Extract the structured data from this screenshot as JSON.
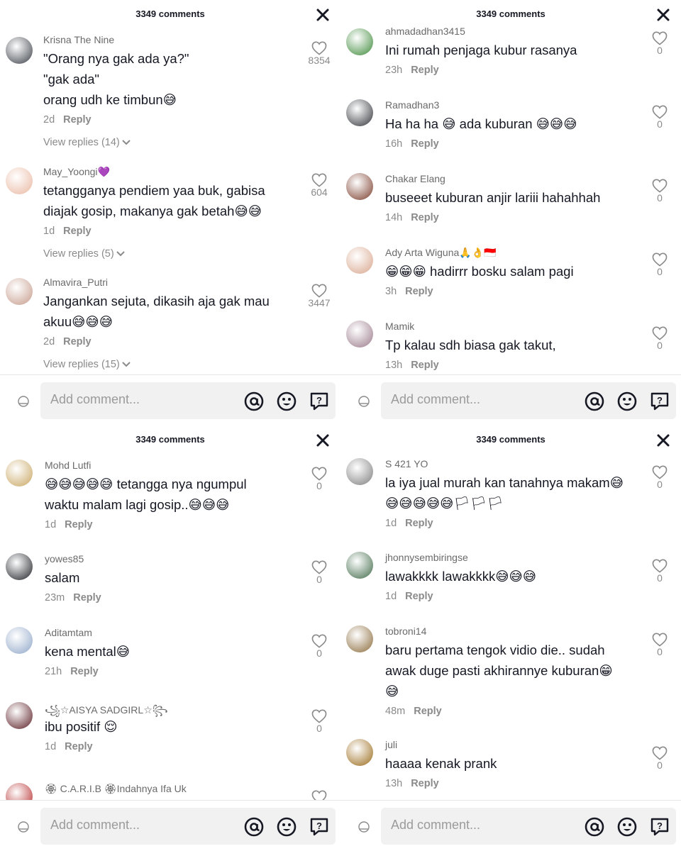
{
  "header": {
    "count_label": "3349 comments"
  },
  "footer": {
    "placeholder": "Add comment..."
  },
  "reply_label": "Reply",
  "panels": [
    {
      "comments": [
        {
          "user": "Krisna The Nine",
          "lines": [
            "\"Orang nya gak ada ya?\"",
            "\"gak ada\"",
            "orang udh ke timbun😅"
          ],
          "time": "2d",
          "likes": "8354",
          "replies": "View replies (14)"
        },
        {
          "user": "May_Yoongi💜",
          "lines": [
            "tetangganya pendiem yaa buk, gabisa",
            "diajak gosip, makanya gak betah😅😅"
          ],
          "time": "1d",
          "likes": "604",
          "replies": "View replies (5)"
        },
        {
          "user": "Almavira_Putri",
          "lines": [
            "Jangankan sejuta, dikasih aja gak mau",
            "akuu😅😅😅"
          ],
          "time": "2d",
          "likes": "3447",
          "replies": "View replies (15)"
        }
      ]
    },
    {
      "comments": [
        {
          "user": "ahmadadhan3415",
          "lines": [
            "Ini rumah penjaga kubur rasanya"
          ],
          "time": "23h",
          "likes": "0"
        },
        {
          "user": "Ramadhan3",
          "lines": [
            "Ha ha ha 😅 ada kuburan 😅😅😅"
          ],
          "time": "16h",
          "likes": "0"
        },
        {
          "user": "Chakar Elang",
          "lines": [
            "buseeet kuburan anjir lariii hahahhah"
          ],
          "time": "14h",
          "likes": "0"
        },
        {
          "user": "Ady Arta Wiguna🙏👌🇮🇩",
          "lines": [
            "😁😁😁 hadirrr bosku salam pagi"
          ],
          "time": "3h",
          "likes": "0"
        },
        {
          "user": "Mamik",
          "lines": [
            "Tp kalau sdh biasa gak takut,"
          ],
          "time": "13h",
          "likes": "0"
        }
      ]
    },
    {
      "comments": [
        {
          "user": "Mohd Lutfi",
          "lines": [
            "😅😅😅😅😅 tetangga nya ngumpul",
            "waktu malam lagi gosip..😅😅😅"
          ],
          "time": "1d",
          "likes": "0"
        },
        {
          "user": "yowes85",
          "lines": [
            "salam"
          ],
          "time": "23m",
          "likes": "0"
        },
        {
          "user": "Aditamtam",
          "lines": [
            "kena mental😅"
          ],
          "time": "21h",
          "likes": "0"
        },
        {
          "user": "꧁☆AISYA SADGIRL☆꧂",
          "lines": [
            "ibu positif 😌"
          ],
          "time": "1d",
          "likes": "0"
        },
        {
          "user": "🏵 C.A.R.I.B 🏵Indahnya Ifa Uk",
          "lines": [],
          "time": "",
          "likes": ""
        }
      ]
    },
    {
      "comments": [
        {
          "user": "S 421 YO",
          "lines": [
            "la iya jual murah kan tanahnya makam😅",
            "😅😅😅😅😅🏳🏳🏳"
          ],
          "time": "1d",
          "likes": "0"
        },
        {
          "user": "jhonnysembiringse",
          "lines": [
            "lawakkkk lawakkkk😅😅😅"
          ],
          "time": "1d",
          "likes": "0"
        },
        {
          "user": "tobroni14",
          "lines": [
            "baru pertama tengok vidio die.. sudah",
            "awak duge pasti akhirannye kuburan😁",
            "😅"
          ],
          "time": "48m",
          "likes": "0"
        },
        {
          "user": "juli",
          "lines": [
            "haaaa kenak prank"
          ],
          "time": "13h",
          "likes": "0"
        }
      ]
    }
  ],
  "avatars": [
    "#3a3f47",
    "#e9b7a0",
    "#c59a8a",
    "#3d8a3a",
    "#2f3238",
    "#7a3b2a",
    "#d8a58c",
    "#9a7a8a",
    "#c8a560",
    "#1c1f24",
    "#8fa6c8",
    "#5a1d24",
    "#b52a2a",
    "#7d7d7d",
    "#3f6a48",
    "#8a6a3a",
    "#9a6a1a"
  ]
}
